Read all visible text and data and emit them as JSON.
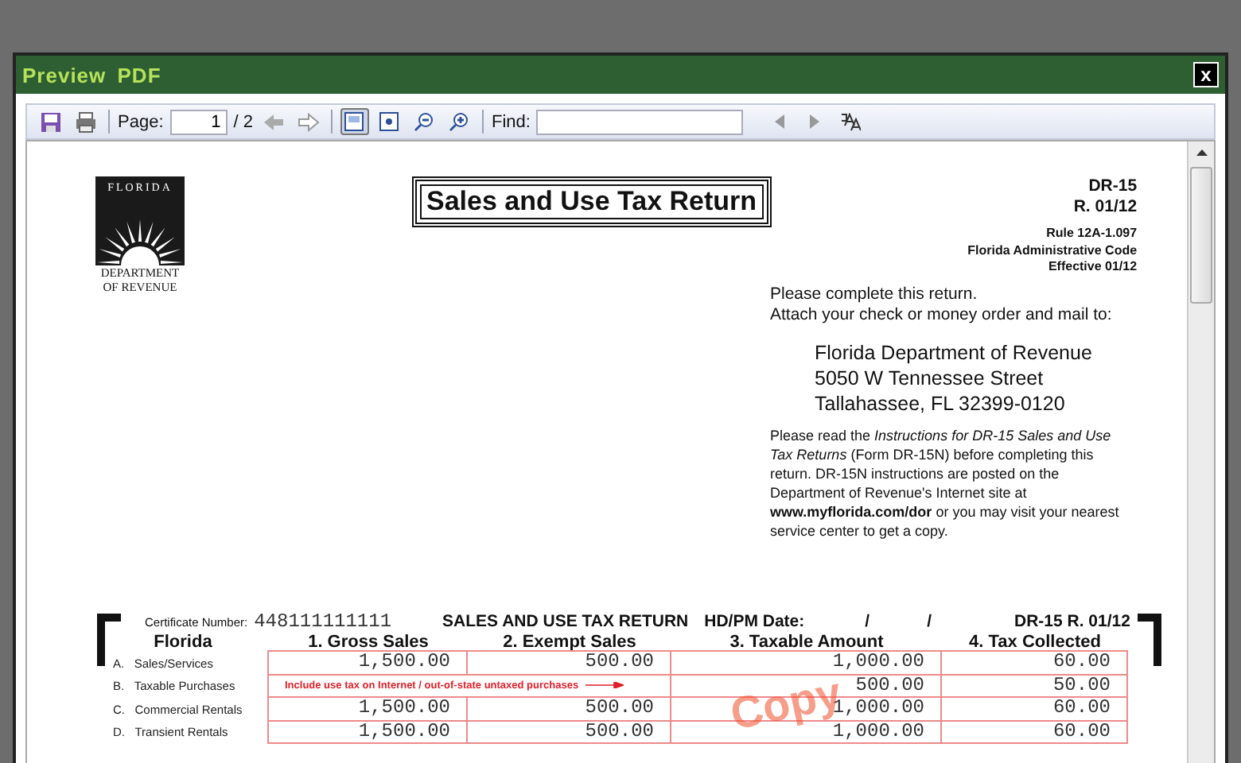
{
  "window": {
    "title": "Preview PDF",
    "close": "x"
  },
  "toolbar": {
    "page_label": "Page:",
    "page_value": "1",
    "page_total": "/ 2",
    "find_label": "Find:"
  },
  "document": {
    "logo": {
      "top": "FLORIDA",
      "bottom": [
        "DEPARTMENT",
        "OF REVENUE"
      ]
    },
    "title": "Sales and Use Tax Return",
    "form_id": [
      "DR-15",
      "R. 01/12"
    ],
    "rule": [
      "Rule 12A-1.097",
      "Florida Administrative Code",
      "Effective 01/12"
    ],
    "intro": [
      "Please complete this return.",
      "Attach your check or money order and mail to:"
    ],
    "address": [
      "Florida Department of Revenue",
      "5050 W Tennessee Street",
      "Tallahassee, FL 32399-0120"
    ],
    "instructions": "Please read the *Instructions for DR-15 Sales and Use Tax Returns* (Form DR-15N) before completing this return.  DR-15N instructions are posted on the Department of Revenue's Internet site at **www.myflorida.com/dor** or you may visit your nearest service center to get a copy.",
    "form": {
      "certificate_label": "Certificate Number:",
      "certificate_number": "448111111111",
      "heading": "SALES AND USE TAX RETURN",
      "date_label": "HD/PM Date:",
      "date_sep": [
        "/",
        "/"
      ],
      "form_ref": "DR-15 R. 01/12",
      "columns": [
        "Florida",
        "1. Gross Sales",
        "2. Exempt Sales",
        "3. Taxable Amount",
        "4. Tax Collected"
      ],
      "rows": [
        {
          "kind": "amounts",
          "letter": "A.",
          "label": "Sales/Services",
          "gross": "1,500.00",
          "exempt": "500.00",
          "taxable": "1,000.00",
          "tax": "60.00"
        },
        {
          "kind": "note",
          "letter": "B.",
          "label": "Taxable Purchases",
          "note": "Include use tax on Internet / out-of-state untaxed purchases",
          "taxable": "500.00",
          "tax": "50.00"
        },
        {
          "kind": "amounts",
          "letter": "C.",
          "label": "Commercial Rentals",
          "gross": "1,500.00",
          "exempt": "500.00",
          "taxable": "1,000.00",
          "tax": "60.00"
        },
        {
          "kind": "amounts",
          "letter": "D.",
          "label": "Transient Rentals",
          "gross": "1,500.00",
          "exempt": "500.00",
          "taxable": "1,000.00",
          "tax": "60.00"
        }
      ],
      "stamp": "Copy"
    }
  }
}
